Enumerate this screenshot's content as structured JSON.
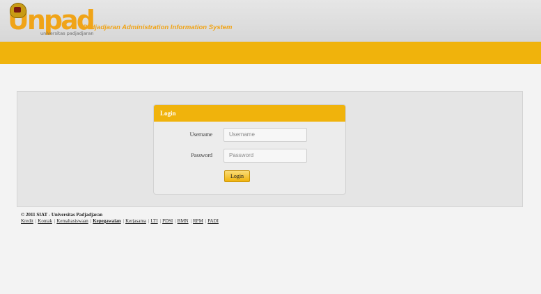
{
  "header": {
    "logo_text": "Unpad",
    "logo_subtext": "universitas padjadjaran",
    "tagline": "Padjadjaran Administration Information System"
  },
  "login": {
    "title": "Login",
    "username_label": "Username",
    "username_placeholder": "Username",
    "password_label": "Password",
    "password_placeholder": "Password",
    "button_label": "Login"
  },
  "footer": {
    "copyright": "© 2011 SIAT - Universitas Padjadjaran",
    "links": [
      "Kredit",
      "Kontak",
      "Kemahasiswaan",
      "Kepegawaian",
      "Kerjasama",
      "LTI",
      "PDSI",
      "BMN",
      "RPM",
      "PADI"
    ]
  },
  "colors": {
    "accent": "#f0b30c",
    "logo": "#f0a418"
  }
}
